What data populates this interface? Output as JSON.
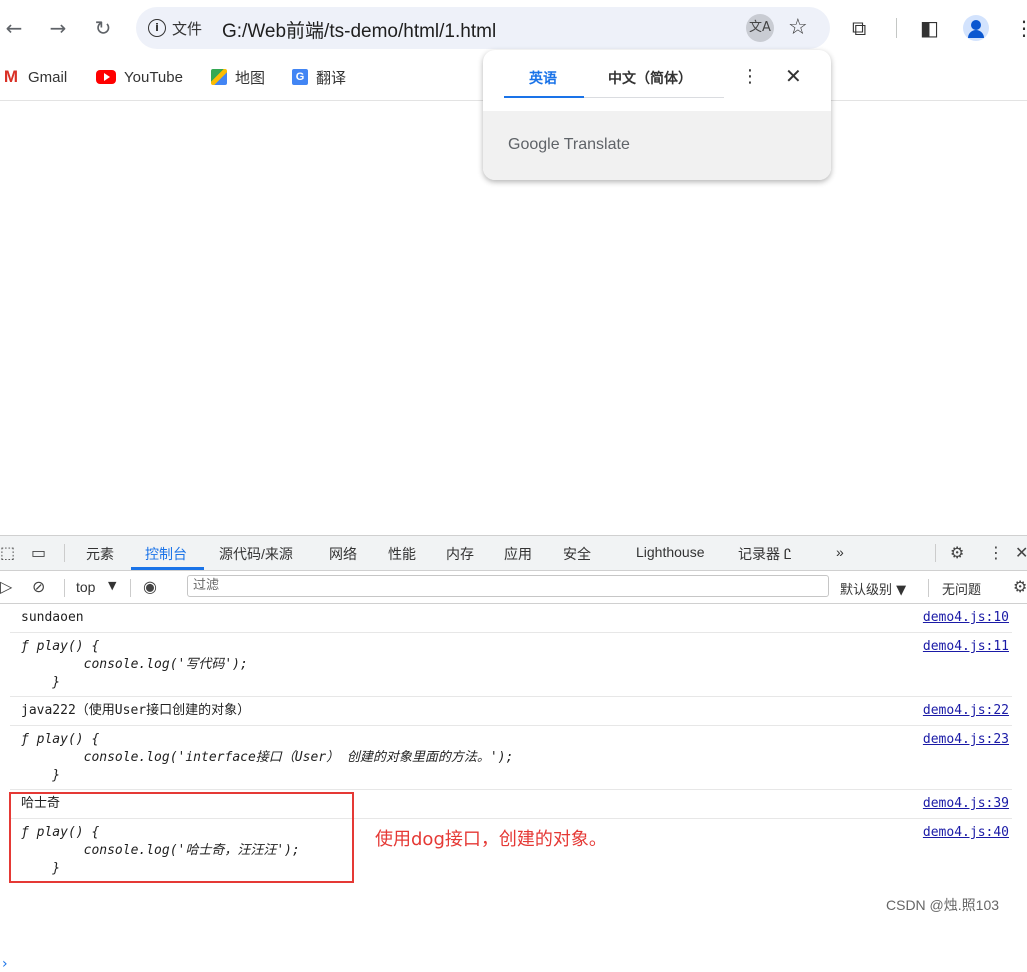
{
  "browser": {
    "omnibox_chip": "文件",
    "url": "G:/Web前端/ts-demo/html/1.html",
    "translate_icon_glyph": "文A",
    "nav_icons": [
      "back-icon",
      "forward-icon",
      "reload-icon"
    ]
  },
  "bookmarks": [
    {
      "label": "Gmail",
      "icon": "gmail-icon",
      "glyph": "M"
    },
    {
      "label": "YouTube",
      "icon": "youtube-icon",
      "glyph": ""
    },
    {
      "label": "地图",
      "icon": "maps-icon",
      "glyph": ""
    },
    {
      "label": "翻译",
      "icon": "translate-icon",
      "glyph": "G"
    }
  ],
  "translate_popup": {
    "tab_source": "英语",
    "tab_target": "中文（简体）",
    "brand": "Google Translate"
  },
  "devtools": {
    "tabs": [
      "元素",
      "控制台",
      "源代码/来源",
      "网络",
      "性能",
      "内存",
      "应用",
      "安全",
      "Lighthouse",
      "记录器 Ꮭ"
    ],
    "active_tab": "控制台",
    "more_tabs": "»",
    "context": "top",
    "filter_placeholder": "过滤",
    "log_level": "默认级别 ▼",
    "issues": "无问题"
  },
  "console_rows": [
    {
      "text": "sundaoen",
      "italic": false,
      "source": "demo4.js:10"
    },
    {
      "text": "ƒ play() {\n        console.log('写代码');\n    }",
      "italic": true,
      "source": "demo4.js:11"
    },
    {
      "text": "java222（使用User接口创建的对象）",
      "italic": false,
      "source": "demo4.js:22"
    },
    {
      "text": "ƒ play() {\n        console.log('interface接口（User） 创建的对象里面的方法。');\n    }",
      "italic": true,
      "source": "demo4.js:23"
    },
    {
      "text": "哈士奇",
      "italic": false,
      "source": "demo4.js:39"
    },
    {
      "text": "ƒ play() {\n        console.log('哈士奇，汪汪汪');\n    }",
      "italic": true,
      "source": "demo4.js:40"
    }
  ],
  "annotation": "使用dog接口，创建的对象。",
  "watermark": "CSDN @烛.照103",
  "colors": {
    "accent": "#1a73e8",
    "annotation": "#e53935"
  }
}
